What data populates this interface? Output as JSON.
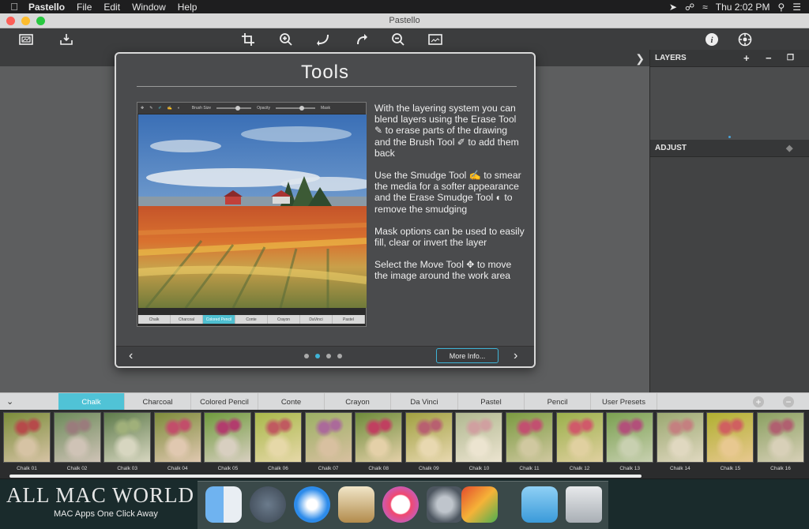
{
  "menubar": {
    "app": "Pastello",
    "items": [
      "File",
      "Edit",
      "Window",
      "Help"
    ],
    "clock": "Thu 2:02 PM"
  },
  "window": {
    "title": "Pastello"
  },
  "toolbar": {
    "left": [
      "image-icon",
      "tray-download-icon"
    ],
    "center": [
      "crop-icon",
      "zoom-in-icon",
      "undo-arrow-icon",
      "redo-arrow-icon",
      "zoom-out-icon",
      "fit-image-icon"
    ],
    "right": [
      "info-icon",
      "settings-icon"
    ]
  },
  "panels": {
    "layers": "LAYERS",
    "adjust": "ADJUST"
  },
  "modal": {
    "title": "Tools",
    "paragraphs": [
      "With the layering system you can blend layers using the Erase Tool ✎ to erase parts of the drawing and the Brush Tool ✐ to add them back",
      "Use the Smudge Tool ✍ to smear the media for a softer appearance and the Erase Smudge Tool ◐ to remove the smudging",
      "Mask options can be used to easily fill, clear or invert the layer",
      "Select the Move Tool ✥ to move the image around the work area"
    ],
    "more_button": "More Info...",
    "pages": 4,
    "current_page": 2,
    "screenshot": {
      "toolbar_labels": [
        "Brush Size",
        "Opacity",
        "Mask"
      ],
      "tabs": [
        "Chalk",
        "Charcoal",
        "Colored Pencil",
        "Conte",
        "Crayon",
        "DaVinci",
        "Pastel"
      ],
      "active_tab": "Colored Pencil"
    }
  },
  "preset_tabs": [
    "Chalk",
    "Charcoal",
    "Colored Pencil",
    "Conte",
    "Crayon",
    "Da Vinci",
    "Pastel",
    "Pencil",
    "User Presets"
  ],
  "active_preset_tab": "Chalk",
  "thumbnails": [
    "Chalk 01",
    "Chalk 02",
    "Chalk 03",
    "Chalk 04",
    "Chalk 05",
    "Chalk 06",
    "Chalk 07",
    "Chalk 08",
    "Chalk 09",
    "Chalk 10",
    "Chalk 11",
    "Chalk 12",
    "Chalk 13",
    "Chalk 14",
    "Chalk 15",
    "Chalk 16"
  ],
  "watermark": {
    "line1": "ALL MAC WORLD",
    "line2": "MAC Apps One Click Away"
  },
  "dock": [
    "finder-icon",
    "launchpad-icon",
    "safari-icon",
    "mail-icon",
    "itunes-icon",
    "system-preferences-icon",
    "pastello-pro-icon",
    "downloads-folder-icon",
    "trash-icon"
  ],
  "colors": {
    "accent": "#3fb3d6",
    "active_tab": "#50c3d6"
  }
}
